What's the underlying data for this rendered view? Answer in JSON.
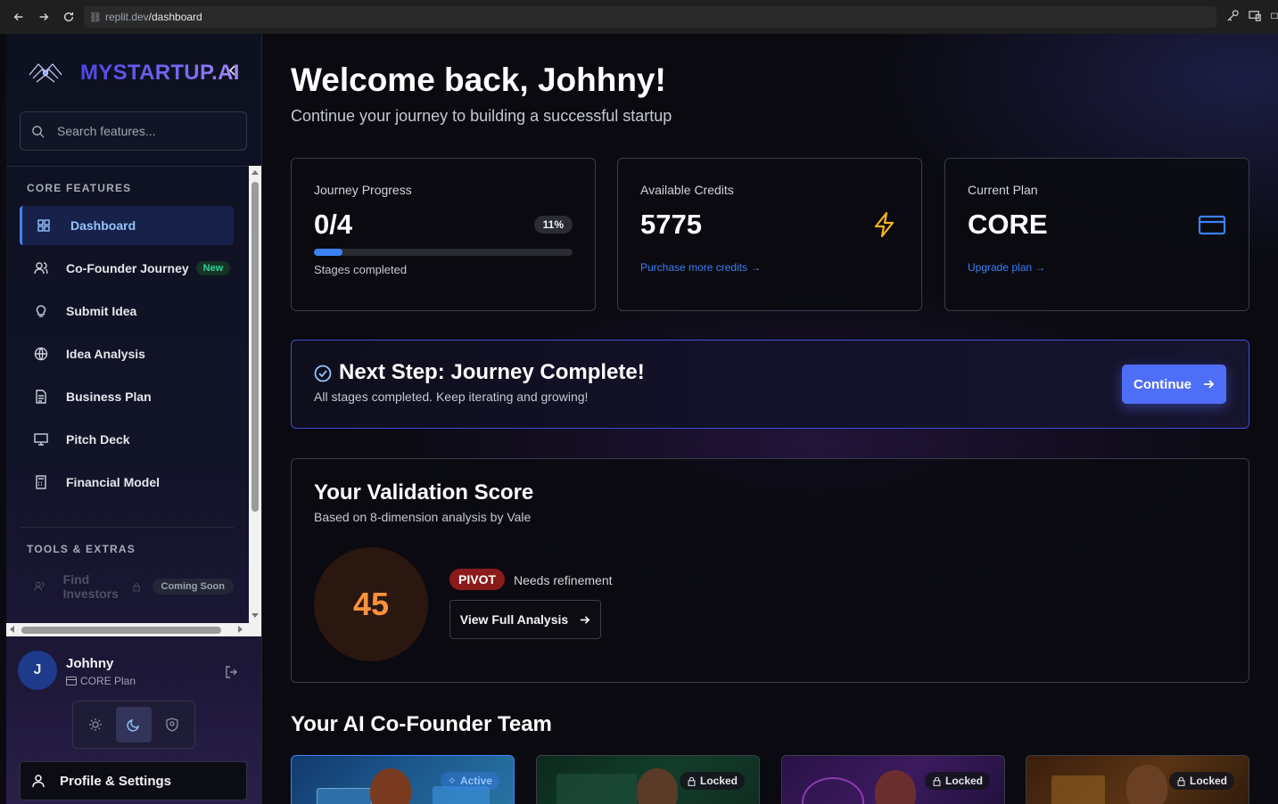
{
  "browser": {
    "url_host": "replit.dev",
    "url_path": "/dashboard"
  },
  "sidebar": {
    "brand": "MYSTARTUP.AI",
    "search_placeholder": "Search features...",
    "core_label": "CORE FEATURES",
    "items": [
      {
        "label": "Dashboard",
        "icon": "grid-icon"
      },
      {
        "label": "Co-Founder Journey",
        "icon": "users-icon",
        "badge": "New"
      },
      {
        "label": "Submit Idea",
        "icon": "lightbulb-icon"
      },
      {
        "label": "Idea Analysis",
        "icon": "globe-icon"
      },
      {
        "label": "Business Plan",
        "icon": "document-icon"
      },
      {
        "label": "Pitch Deck",
        "icon": "presentation-icon"
      },
      {
        "label": "Financial Model",
        "icon": "calculator-icon"
      }
    ],
    "tools_label": "TOOLS & EXTRAS",
    "tools": [
      {
        "label": "Find Investors",
        "icon": "users-icon",
        "badge": "Coming Soon"
      }
    ],
    "user": {
      "initial": "J",
      "name": "Johhny",
      "plan": "CORE Plan"
    },
    "profile_label": "Profile & Settings"
  },
  "main": {
    "welcome": "Welcome back, Johhny!",
    "subtitle": "Continue your journey to building a successful startup",
    "stats": {
      "progress": {
        "label": "Journey Progress",
        "value": "0/4",
        "percent": "11%",
        "fill": 0.11,
        "foot": "Stages completed"
      },
      "credits": {
        "label": "Available Credits",
        "value": "5775",
        "link": "Purchase more credits →",
        "icon": "lightning-icon"
      },
      "plan": {
        "label": "Current Plan",
        "value": "CORE",
        "link": "Upgrade plan →",
        "icon": "credit-card-icon"
      }
    },
    "next_step": {
      "title": "Next Step: Journey Complete!",
      "subtitle": "All stages completed. Keep iterating and growing!",
      "button": "Continue"
    },
    "validation": {
      "title": "Your Validation Score",
      "subtitle": "Based on 8-dimension analysis by Vale",
      "score": "45",
      "verdict": "PIVOT",
      "verdict_text": "Needs refinement",
      "button": "View Full Analysis"
    },
    "team": {
      "title": "Your AI Co-Founder Team",
      "cards": [
        {
          "status": "Active"
        },
        {
          "status": "Locked"
        },
        {
          "status": "Locked"
        },
        {
          "status": "Locked"
        }
      ]
    }
  },
  "colors": {
    "accent": "#3b82f6",
    "brand_gradient_start": "#4f46e5",
    "credits_icon": "#f5b41e",
    "score": "#fb923c",
    "pivot": "#8b1a1a"
  }
}
